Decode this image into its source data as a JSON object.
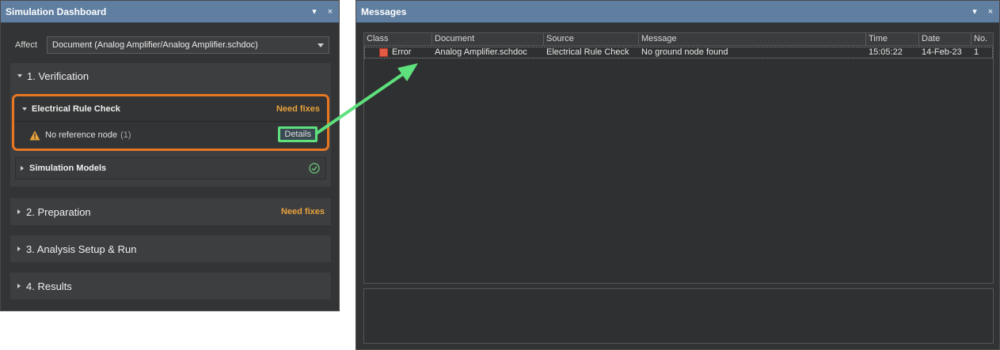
{
  "dashboard": {
    "title": "Simulation Dashboard",
    "affect_label": "Affect",
    "affect_value": "Document (Analog Amplifier/Analog Amplifier.schdoc)",
    "sections": {
      "verification": "1. Verification",
      "preparation": "2. Preparation",
      "preparation_status": "Need fixes",
      "analysis": "3. Analysis Setup & Run",
      "results": "4. Results"
    },
    "erc": {
      "title": "Electrical Rule Check",
      "status": "Need fixes",
      "item_label": "No reference node",
      "item_count": "(1)",
      "details_label": "Details"
    },
    "sim_models": {
      "title": "Simulation Models"
    },
    "colors": {
      "need_fixes": "#e8a23c",
      "highlight_orange": "#e87722",
      "highlight_green": "#5ee07d",
      "titlebar": "#5f7ea0"
    }
  },
  "messages": {
    "title": "Messages",
    "columns": [
      "Class",
      "Document",
      "Source",
      "Message",
      "Time",
      "Date",
      "No."
    ],
    "rows": [
      {
        "class": "Error",
        "document": "Analog Amplifier.schdoc",
        "source": "Electrical Rule Check",
        "message": "No ground node found",
        "time": "15:05:22",
        "date": "14-Feb-23",
        "no": "1"
      }
    ]
  },
  "window_controls": {
    "pin": "▾",
    "close": "×"
  }
}
